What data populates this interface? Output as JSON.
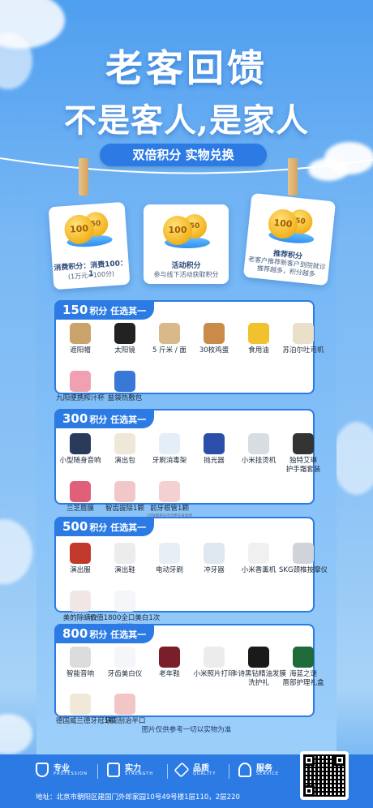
{
  "header": {
    "title_line1": "老客回馈",
    "title_line2": "不是客人,是家人",
    "banner": "双倍积分 实物兑换"
  },
  "cards": [
    {
      "coin_big": "100",
      "coin_small": "50",
      "title": "消费积分：消费100：1",
      "sub": "(1万元=100分)"
    },
    {
      "coin_big": "100",
      "coin_small": "50",
      "title": "活动积分",
      "sub": "参与线下活动获取积分"
    },
    {
      "coin_big": "100",
      "coin_small": "50",
      "title": "推荐积分",
      "sub": "老客户推荐新客户到院就诊",
      "sub2": "推荐越多，积分越多"
    }
  ],
  "sections": [
    {
      "points": "150",
      "label": "积分 任选其一",
      "items": [
        {
          "label": "遮阳帽",
          "icon": "sun-hat-icon",
          "color": "#c9a36a"
        },
        {
          "label": "太阳镜",
          "icon": "sunglasses-icon",
          "color": "#222222"
        },
        {
          "label": "5 斤米 / 面",
          "icon": "rice-bag-icon",
          "color": "#d9b98a"
        },
        {
          "label": "30枚鸡蛋",
          "icon": "eggs-icon",
          "color": "#c98a4a"
        },
        {
          "label": "食用油",
          "icon": "oil-bottle-icon",
          "color": "#f2c12e"
        },
        {
          "label": "苏泊尔吐司机",
          "icon": "toaster-icon",
          "color": "#eadfc8"
        },
        {
          "label": "九阳便携榨汁杯",
          "icon": "juicer-icon",
          "color": "#f0a0b0"
        },
        {
          "label": "盐袋热敷包",
          "icon": "salt-pack-icon",
          "color": "#3a78d8"
        }
      ]
    },
    {
      "points": "300",
      "label": "积分 任选其一",
      "items": [
        {
          "label": "小型随身音响",
          "icon": "speaker-icon",
          "color": "#2a3a5a"
        },
        {
          "label": "演出包",
          "icon": "tote-bag-icon",
          "color": "#efe8d8"
        },
        {
          "label": "牙刷消毒架",
          "icon": "toothbrush-sterilizer-icon",
          "color": "#e4eef8"
        },
        {
          "label": "抛光器",
          "icon": "polisher-icon",
          "color": "#2b4fa8"
        },
        {
          "label": "小米挂烫机",
          "icon": "garment-steamer-icon",
          "color": "#d8dde4"
        },
        {
          "label": "独特艾琳\n护手霜套装",
          "icon": "hand-cream-set-icon",
          "color": "#333333"
        },
        {
          "label": "兰芝唇膜",
          "icon": "lip-mask-icon",
          "color": "#e0607a"
        },
        {
          "label": "智齿拔除1颗",
          "icon": "wisdom-tooth-icon",
          "color": "#f2c7c7"
        },
        {
          "label": "前牙根管1颗",
          "icon": "root-canal-icon",
          "color": "#f4d0d0",
          "note": "(仅限量积分不可用于发放项目)"
        }
      ]
    },
    {
      "points": "500",
      "label": "积分 任选其一",
      "items": [
        {
          "label": "演出服",
          "icon": "jacket-icon",
          "color": "#c0392b"
        },
        {
          "label": "演出鞋",
          "icon": "shoes-icon",
          "color": "#ececec"
        },
        {
          "label": "电动牙刷",
          "icon": "electric-toothbrush-icon",
          "color": "#e8eef6"
        },
        {
          "label": "冲牙器",
          "icon": "water-flosser-icon",
          "color": "#dfe8f0"
        },
        {
          "label": "小米香薰机",
          "icon": "aroma-diffuser-icon",
          "color": "#f0f0f0"
        },
        {
          "label": "SKG颈椎按摩仪",
          "icon": "neck-massager-icon",
          "color": "#d0d4da"
        },
        {
          "label": "美的除螨仪",
          "icon": "mite-remover-icon",
          "color": "#f0e6e6"
        },
        {
          "label": "价值1800全口美白1次",
          "icon": "tooth-icon",
          "color": "#f4f6fa",
          "note": "(高端修复)"
        }
      ]
    },
    {
      "points": "800",
      "label": "积分 任选其一",
      "items": [
        {
          "label": "智能音响",
          "icon": "smart-speaker-icon",
          "color": "#dcdcdc"
        },
        {
          "label": "牙齿美白仪",
          "icon": "whitening-device-icon",
          "color": "#f4f6fa"
        },
        {
          "label": "老年鞋",
          "icon": "sneaker-icon",
          "color": "#7a1f2a"
        },
        {
          "label": "小米照片打印",
          "icon": "photo-printer-icon",
          "color": "#ececec"
        },
        {
          "label": "卡诗黑钻精油发膜\n洗护礼",
          "icon": "hair-care-set-icon",
          "color": "#1a1a1a"
        },
        {
          "label": "海蓝之谜\n唇部护理礼盒",
          "icon": "lip-care-box-icon",
          "color": "#1f6a3a"
        },
        {
          "label": "德国威兰德牙冠1颗",
          "icon": "dental-crown-icon",
          "color": "#f1e9d8"
        },
        {
          "label": "牙周刮治半口",
          "icon": "periodontal-icon",
          "color": "#f3c6c6"
        }
      ]
    }
  ],
  "footnote": "图片仅供参考一切以实物为准",
  "footer": {
    "features": [
      {
        "zh": "专业",
        "en": "PROFESSION",
        "icon": "shield-icon"
      },
      {
        "zh": "实力",
        "en": "STRENGTH",
        "icon": "building-icon"
      },
      {
        "zh": "品质",
        "en": "QUALITY",
        "icon": "diamond-icon"
      },
      {
        "zh": "服务",
        "en": "SERVICE",
        "icon": "user-service-icon"
      }
    ],
    "address": "地址：北京市朝阳区建国门外郎家园10号49号楼1层110，2层220"
  },
  "colors": {
    "accent": "#2c7be5",
    "background": "#79b8f4"
  }
}
